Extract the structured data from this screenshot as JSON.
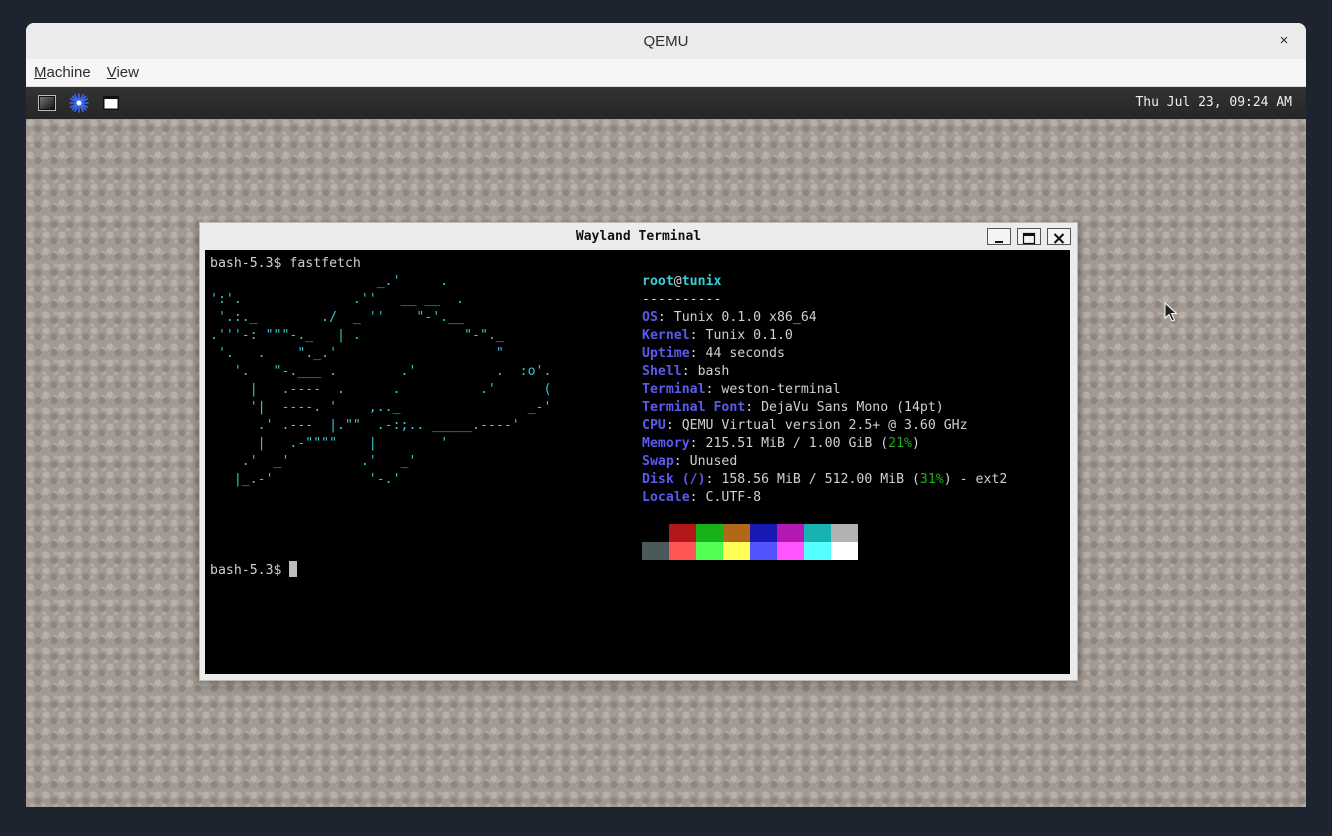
{
  "qemu": {
    "title": "QEMU",
    "close_glyph": "×",
    "menu": [
      {
        "label_u": "M",
        "label_rest": "achine"
      },
      {
        "label_u": "V",
        "label_rest": "iew"
      }
    ]
  },
  "panel": {
    "clock": "Thu Jul 23, 09:24 AM",
    "icons": [
      "terminal-launcher-icon",
      "weston-star-icon",
      "window-icon"
    ]
  },
  "terminal": {
    "title": "Wayland Terminal",
    "prompt1": "bash-5.3$ fastfetch",
    "prompt2": "bash-5.3$ ",
    "ascii_art": "                     _.'     .\n':'.              .''   __ __  .\n '.:._        ./  _ ''    \"-'.__\n.'''-: \"\"\"-._   | .             \"-\"._\n '.   .    \"._.'                    \"\n   '.   \"-.___ .        .'          .  :o'.\n     |   .----  .      .          .'      (\n     '|  ----. '    ,.._                _-'\n      .' .---  |.\"\"  .-:;.. _____.----'\n      |   .-\"\"\"\"    |        '\n    .'  _'         .'   _'\n   |_.-'            '-.'",
    "user": "root",
    "at": "@",
    "host": "tunix",
    "separator": "----------",
    "fields": {
      "os": {
        "key": "OS",
        "value": "Tunix 0.1.0 x86_64"
      },
      "kernel": {
        "key": "Kernel",
        "value": "Tunix 0.1.0"
      },
      "uptime": {
        "key": "Uptime",
        "value": "44 seconds"
      },
      "shell": {
        "key": "Shell",
        "value": "bash"
      },
      "terminal": {
        "key": "Terminal",
        "value": "weston-terminal"
      },
      "terminal_font": {
        "key": "Terminal Font",
        "value": "DejaVu Sans Mono (14pt)"
      },
      "cpu": {
        "key": "CPU",
        "value": "QEMU Virtual version 2.5+ @ 3.60 GHz"
      },
      "memory": {
        "key": "Memory",
        "value_pre": "215.51 MiB / 1.00 GiB (",
        "percent": "21%",
        "value_post": ")"
      },
      "swap": {
        "key": "Swap",
        "value": "Unused"
      },
      "disk": {
        "key": "Disk (/)",
        "value_pre": "158.56 MiB / 512.00 MiB (",
        "percent": "31%",
        "value_post": ") - ext2"
      },
      "locale": {
        "key": "Locale",
        "value": "C.UTF-8"
      }
    },
    "palette_row1": [
      "#000000",
      "#b21818",
      "#18b218",
      "#b26818",
      "#1818b2",
      "#b218b2",
      "#18b2b2",
      "#b2b2b2"
    ],
    "palette_row2": [
      "#4a5a5a",
      "#ff5454",
      "#54ff54",
      "#ffff54",
      "#5454ff",
      "#ff54ff",
      "#54ffff",
      "#ffffff"
    ]
  }
}
